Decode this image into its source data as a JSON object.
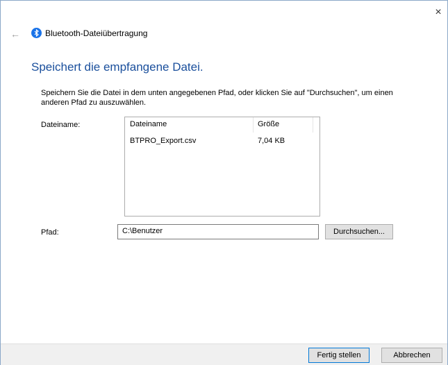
{
  "window": {
    "close_glyph": "×",
    "back_glyph": "←",
    "title": "Bluetooth-Dateiübertragung"
  },
  "main": {
    "heading": "Speichert die empfangene Datei.",
    "description": "Speichern Sie die Datei in dem unten angegebenen Pfad, oder klicken Sie auf \"Durchsuchen\", um einen anderen Pfad zu auszuwählen.",
    "filename_label": "Dateiname:",
    "path_label": "Pfad:",
    "table": {
      "headers": [
        "Dateiname",
        "Größe"
      ],
      "rows": [
        {
          "name": "BTPRO_Export.csv",
          "size": "7,04 KB"
        }
      ]
    },
    "path_value": "C:\\Benutzer",
    "browse_button": "Durchsuchen..."
  },
  "footer": {
    "finish_button": "Fertig stellen",
    "cancel_button": "Abbrechen"
  },
  "colors": {
    "accent": "#1a4f9c",
    "bluetooth": "#1a73e8",
    "default_button_border": "#0078d7"
  },
  "icons": {
    "bluetooth": "bluetooth-icon",
    "close": "close-icon",
    "back": "back-arrow-icon"
  }
}
